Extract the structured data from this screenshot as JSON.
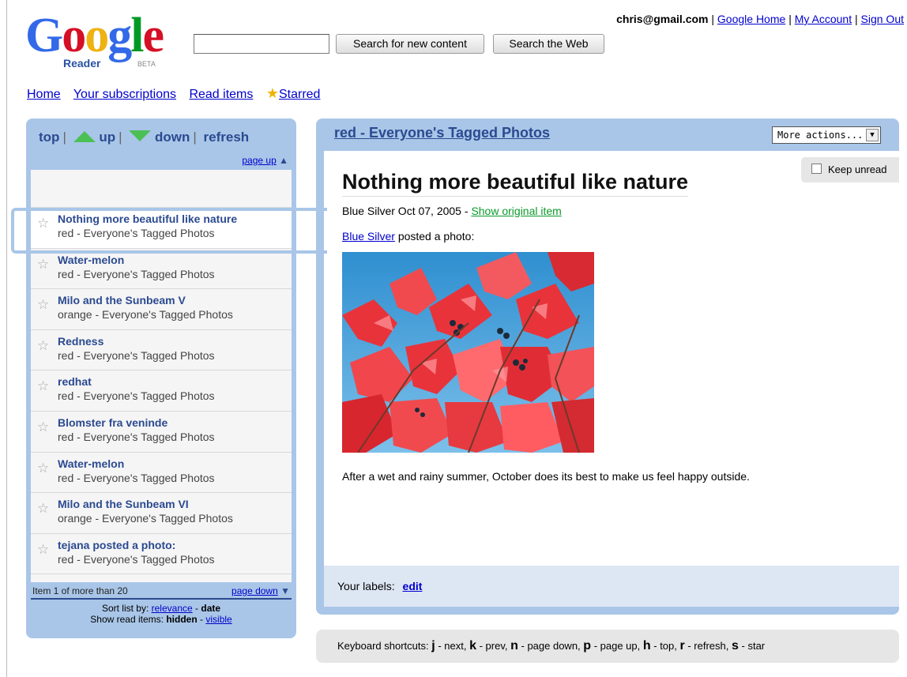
{
  "header": {
    "logo_letters": [
      {
        "ch": "G",
        "color": "#3369e8"
      },
      {
        "ch": "o",
        "color": "#d50f25"
      },
      {
        "ch": "o",
        "color": "#eeb211"
      },
      {
        "ch": "g",
        "color": "#3369e8"
      },
      {
        "ch": "l",
        "color": "#009925"
      },
      {
        "ch": "e",
        "color": "#d50f25"
      }
    ],
    "logo_sub": "Reader",
    "logo_beta": "BETA",
    "search_value": "",
    "search_new_label": "Search for new content",
    "search_web_label": "Search the Web"
  },
  "user": {
    "email": "chris@gmail.com",
    "sep": "|",
    "google_home": "Google Home",
    "my_account": "My Account",
    "sign_out": "Sign Out"
  },
  "nav": {
    "home": "Home",
    "subscriptions": "Your subscriptions",
    "read_items": "Read items",
    "starred": "Starred"
  },
  "list": {
    "nav_top": "top",
    "nav_up": "up",
    "nav_down": "down",
    "nav_refresh": "refresh",
    "page_up": "page up",
    "items": [
      {
        "title": "Nothing more beautiful like nature",
        "source": "red - Everyone's Tagged Photos",
        "selected": true
      },
      {
        "title": "Water-melon",
        "source": "red - Everyone's Tagged Photos"
      },
      {
        "title": "Milo and the Sunbeam V",
        "source": "orange - Everyone's Tagged Photos"
      },
      {
        "title": "Redness",
        "source": "red - Everyone's Tagged Photos"
      },
      {
        "title": "redhat",
        "source": "red - Everyone's Tagged Photos"
      },
      {
        "title": "Blomster fra veninde",
        "source": "red - Everyone's Tagged Photos"
      },
      {
        "title": "Water-melon",
        "source": "red - Everyone's Tagged Photos"
      },
      {
        "title": "Milo and the Sunbeam VI",
        "source": "orange - Everyone's Tagged Photos"
      },
      {
        "title": "tejana posted a photo:",
        "source": "red - Everyone's Tagged Photos"
      }
    ],
    "count_text": "Item 1 of more than 20",
    "page_down": "page down",
    "sort_label": "Sort list by:",
    "sort_relevance": "relevance",
    "sort_date": "date",
    "show_label": "Show read items:",
    "show_hidden": "hidden",
    "show_visible": "visible",
    "dash": "-"
  },
  "reader": {
    "feed_title": "red - Everyone's Tagged Photos",
    "more_actions": "More actions...",
    "keep_unread": "Keep unread",
    "article_title": "Nothing more beautiful like nature",
    "article_meta": "Blue Silver Oct 07, 2005",
    "meta_sep": "-",
    "show_original": "Show original item",
    "author_link": "Blue Silver",
    "posted_text": "posted a photo:",
    "caption": "After a wet and rainy summer, October does its best to make us feel happy outside.",
    "labels_label": "Your labels:",
    "labels_edit": "edit"
  },
  "shortcuts": {
    "label": "Keyboard shortcuts:",
    "keys": [
      {
        "key": "j",
        "desc": "next"
      },
      {
        "key": "k",
        "desc": "prev"
      },
      {
        "key": "n",
        "desc": "page down"
      },
      {
        "key": "p",
        "desc": "page up"
      },
      {
        "key": "h",
        "desc": "top"
      },
      {
        "key": "r",
        "desc": "refresh"
      },
      {
        "key": "s",
        "desc": "star"
      }
    ]
  },
  "colors": {
    "panel_blue": "#a9c6e8",
    "title_blue": "#2b4a90",
    "link_blue": "#0000cc",
    "original_green": "#0a9a29",
    "arrow_green": "#4cbf55"
  }
}
